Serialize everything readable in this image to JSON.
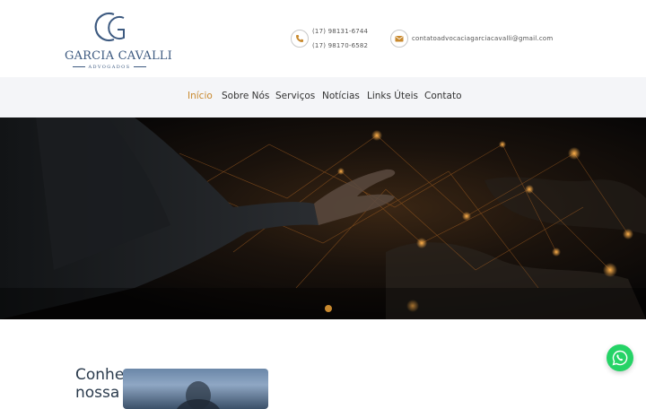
{
  "logo": {
    "monogram": "GC",
    "name": "GARCIA CAVALLI",
    "subtitle": "ADVOGADOS"
  },
  "contact": {
    "phone_icon": "phone-icon",
    "phone_1": "(17) 98131-6744",
    "phone_2": "(17) 98170-6582",
    "email_icon": "envelope-icon",
    "email": "contatoadvocaciagarciacavalli@gmail.com"
  },
  "nav": {
    "items": [
      {
        "label": "Início",
        "active": true
      },
      {
        "label": "Sobre Nós",
        "active": false
      },
      {
        "label": "Serviços",
        "active": false
      },
      {
        "label": "Notícias",
        "active": false
      },
      {
        "label": "Links Úteis",
        "active": false
      },
      {
        "label": "Contato",
        "active": false
      }
    ]
  },
  "hero": {
    "slides": 1,
    "active_slide": 1
  },
  "intro": {
    "heading": "Conhe\nnossa"
  },
  "whatsapp": {
    "icon": "whatsapp-icon"
  },
  "colors": {
    "accent": "#c8892e",
    "brand_blue": "#3d5a80",
    "nav_bg": "#f4f5f8",
    "whatsapp_green": "#25d366"
  }
}
